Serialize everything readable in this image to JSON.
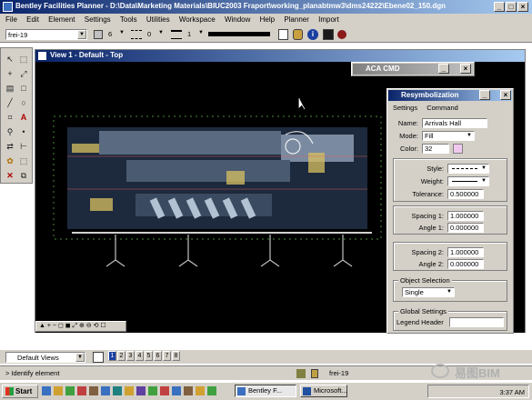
{
  "app": {
    "title": "Bentley Facilities Planner - D:\\Data\\Marketing Materials\\BIUC2003 Fraport\\working_planabtmw3\\dms24222\\Ebene02_150.dgn"
  },
  "menu": [
    "File",
    "Edit",
    "Element",
    "Settings",
    "Tools",
    "Utilities",
    "Workspace",
    "Window",
    "Help",
    "Planner",
    "Import"
  ],
  "toolbar": {
    "level": "frei-19",
    "color_value": "6",
    "style_value": "0",
    "weight_value": "1"
  },
  "view": {
    "title": "View 1 - Default - Top"
  },
  "aca_cmd": {
    "title": "ACA CMD"
  },
  "resymb": {
    "title": "Resymbolization",
    "menu": [
      "Settings",
      "Command"
    ],
    "name_label": "Name:",
    "name_value": "Arrivals Hall",
    "mode_label": "Mode:",
    "mode_value": "Fill",
    "color_label": "Color:",
    "color_value": "32",
    "color_swatch": "#f0c8ee",
    "style_label": "Style:",
    "weight_label": "Weight:",
    "tolerance_label": "Tolerance:",
    "tolerance_value": "0.500000",
    "spacing1_label": "Spacing 1:",
    "spacing1_value": "1.000000",
    "angle1_label": "Angle 1:",
    "angle1_value": "0.000000",
    "spacing2_label": "Spacing 2:",
    "spacing2_value": "1.000000",
    "angle2_label": "Angle 2:",
    "angle2_value": "0.000000",
    "object_selection_label": "Object Selection",
    "object_selection_value": "Single",
    "global_settings_label": "Global Settings",
    "legend_header_label": "Legend Header"
  },
  "views_bar": {
    "selected": "Default Views",
    "pages": [
      "1",
      "2",
      "3",
      "4",
      "5",
      "6",
      "7",
      "8"
    ]
  },
  "status": {
    "message": "> Identify element",
    "level": "frei-19"
  },
  "taskbar": {
    "start_label": "Start",
    "tasks": [
      "Bentley F...",
      "Microsoft..."
    ],
    "clock": "3:37 AM"
  },
  "watermark": {
    "text": "易图BIM"
  },
  "colors": {
    "drawing_bg": "#000000",
    "face": "#d4d0c8",
    "titlebar": "#0a246a"
  }
}
